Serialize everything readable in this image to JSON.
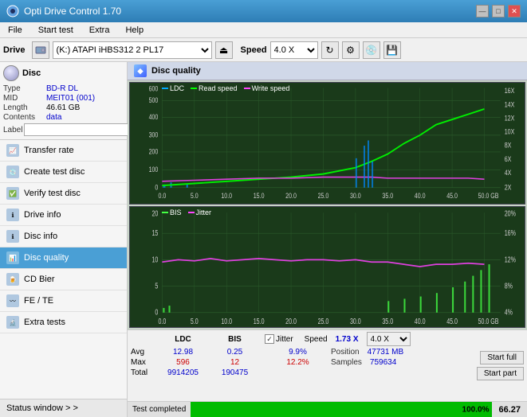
{
  "titlebar": {
    "title": "Opti Drive Control 1.70",
    "minimize": "—",
    "maximize": "□",
    "close": "✕"
  },
  "menubar": {
    "items": [
      "File",
      "Start test",
      "Extra",
      "Help"
    ]
  },
  "toolbar": {
    "drive_label": "Drive",
    "drive_value": "(K:)  ATAPI iHBS312  2 PL17",
    "speed_label": "Speed",
    "speed_value": "4.0 X"
  },
  "disc": {
    "label": "Disc",
    "type_key": "Type",
    "type_val": "BD-R DL",
    "mid_key": "MID",
    "mid_val": "MEIT01 (001)",
    "length_key": "Length",
    "length_val": "46.61 GB",
    "contents_key": "Contents",
    "contents_val": "data",
    "label_key": "Label",
    "label_val": ""
  },
  "nav": {
    "items": [
      {
        "id": "transfer-rate",
        "label": "Transfer rate"
      },
      {
        "id": "create-test-disc",
        "label": "Create test disc"
      },
      {
        "id": "verify-test-disc",
        "label": "Verify test disc"
      },
      {
        "id": "drive-info",
        "label": "Drive info"
      },
      {
        "id": "disc-info",
        "label": "Disc info"
      },
      {
        "id": "disc-quality",
        "label": "Disc quality",
        "active": true
      },
      {
        "id": "cd-bier",
        "label": "CD Bier"
      },
      {
        "id": "fe-te",
        "label": "FE / TE"
      },
      {
        "id": "extra-tests",
        "label": "Extra tests"
      }
    ],
    "status_window": "Status window > >"
  },
  "disc_quality": {
    "title": "Disc quality",
    "chart1": {
      "legend": [
        {
          "label": "LDC",
          "color": "#00aaff"
        },
        {
          "label": "Read speed",
          "color": "#00ff00"
        },
        {
          "label": "Write speed",
          "color": "#ff44ff"
        }
      ],
      "y_max": 600,
      "y_labels": [
        "600",
        "500",
        "400",
        "300",
        "200",
        "100"
      ],
      "y_right_labels": [
        "18X",
        "16X",
        "14X",
        "12X",
        "10X",
        "8X",
        "6X",
        "4X",
        "2X"
      ],
      "x_labels": [
        "0.0",
        "5.0",
        "10.0",
        "15.0",
        "20.0",
        "25.0",
        "30.0",
        "35.0",
        "40.0",
        "45.0",
        "50.0 GB"
      ]
    },
    "chart2": {
      "legend": [
        {
          "label": "BIS",
          "color": "#44ff44"
        },
        {
          "label": "Jitter",
          "color": "#ff44ff"
        }
      ],
      "y_max": 20,
      "y_labels": [
        "20",
        "15",
        "10",
        "5"
      ],
      "y_right_labels": [
        "20%",
        "16%",
        "12%",
        "8%",
        "4%"
      ],
      "x_labels": [
        "0.0",
        "5.0",
        "10.0",
        "15.0",
        "20.0",
        "25.0",
        "30.0",
        "35.0",
        "40.0",
        "45.0",
        "50.0 GB"
      ]
    }
  },
  "stats": {
    "headers": [
      "",
      "LDC",
      "BIS",
      "",
      "Jitter",
      "Speed",
      "",
      ""
    ],
    "avg_label": "Avg",
    "avg_ldc": "12.98",
    "avg_bis": "0.25",
    "avg_jitter": "9.9%",
    "max_label": "Max",
    "max_ldc": "596",
    "max_bis": "12",
    "max_jitter": "12.2%",
    "total_label": "Total",
    "total_ldc": "9914205",
    "total_bis": "190475",
    "speed_current": "1.73 X",
    "speed_select": "4.0 X",
    "position_label": "Position",
    "position_val": "47731 MB",
    "samples_label": "Samples",
    "samples_val": "759634",
    "jitter_checked": "✓",
    "start_full": "Start full",
    "start_part": "Start part"
  },
  "statusbar": {
    "status_text": "Test completed",
    "progress_pct": "100.0%",
    "score": "66.27"
  }
}
